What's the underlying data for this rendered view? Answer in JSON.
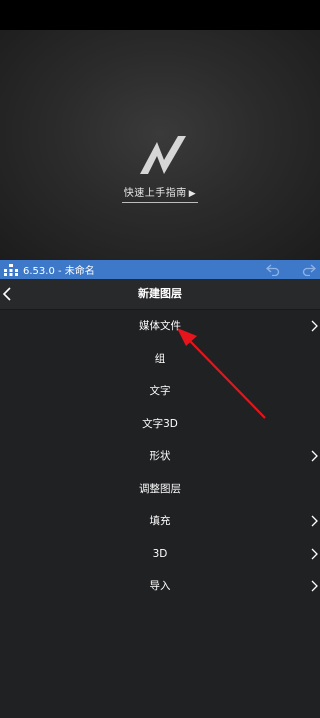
{
  "preview": {
    "guide_label": "快速上手指南",
    "play_symbol": "▶"
  },
  "appbar": {
    "title": "6.53.0 - 未命名"
  },
  "header": {
    "title": "新建图层"
  },
  "menu": {
    "items": [
      {
        "label": "媒体文件",
        "has_submenu": true
      },
      {
        "label": "组",
        "has_submenu": false
      },
      {
        "label": "文字",
        "has_submenu": false
      },
      {
        "label": "文字3D",
        "has_submenu": false
      },
      {
        "label": "形状",
        "has_submenu": true
      },
      {
        "label": "调整图层",
        "has_submenu": false
      },
      {
        "label": "填充",
        "has_submenu": true
      },
      {
        "label": "3D",
        "has_submenu": true
      },
      {
        "label": "导入",
        "has_submenu": true
      }
    ]
  },
  "colors": {
    "appbar": "#3e79c9",
    "background": "#202123",
    "annotation_arrow": "#e8141c"
  },
  "icons": [
    "app-icon",
    "undo-icon",
    "redo-icon",
    "back-arrow-icon",
    "chevron-right-icon",
    "logo-icon"
  ]
}
